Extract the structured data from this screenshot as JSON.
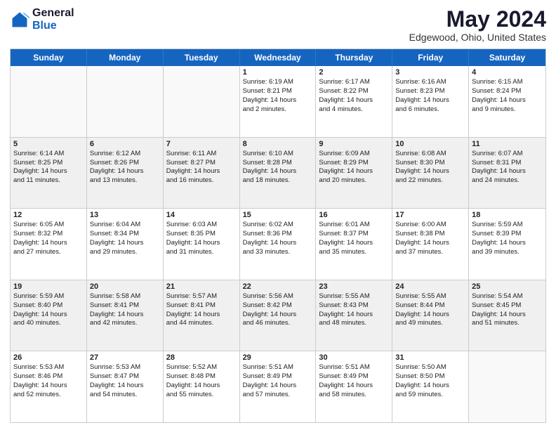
{
  "logo": {
    "general": "General",
    "blue": "Blue"
  },
  "title": "May 2024",
  "subtitle": "Edgewood, Ohio, United States",
  "header_days": [
    "Sunday",
    "Monday",
    "Tuesday",
    "Wednesday",
    "Thursday",
    "Friday",
    "Saturday"
  ],
  "rows": [
    [
      {
        "day": "",
        "lines": [],
        "empty": true
      },
      {
        "day": "",
        "lines": [],
        "empty": true
      },
      {
        "day": "",
        "lines": [],
        "empty": true
      },
      {
        "day": "1",
        "lines": [
          "Sunrise: 6:19 AM",
          "Sunset: 8:21 PM",
          "Daylight: 14 hours",
          "and 2 minutes."
        ]
      },
      {
        "day": "2",
        "lines": [
          "Sunrise: 6:17 AM",
          "Sunset: 8:22 PM",
          "Daylight: 14 hours",
          "and 4 minutes."
        ]
      },
      {
        "day": "3",
        "lines": [
          "Sunrise: 6:16 AM",
          "Sunset: 8:23 PM",
          "Daylight: 14 hours",
          "and 6 minutes."
        ]
      },
      {
        "day": "4",
        "lines": [
          "Sunrise: 6:15 AM",
          "Sunset: 8:24 PM",
          "Daylight: 14 hours",
          "and 9 minutes."
        ]
      }
    ],
    [
      {
        "day": "5",
        "lines": [
          "Sunrise: 6:14 AM",
          "Sunset: 8:25 PM",
          "Daylight: 14 hours",
          "and 11 minutes."
        ]
      },
      {
        "day": "6",
        "lines": [
          "Sunrise: 6:12 AM",
          "Sunset: 8:26 PM",
          "Daylight: 14 hours",
          "and 13 minutes."
        ]
      },
      {
        "day": "7",
        "lines": [
          "Sunrise: 6:11 AM",
          "Sunset: 8:27 PM",
          "Daylight: 14 hours",
          "and 16 minutes."
        ]
      },
      {
        "day": "8",
        "lines": [
          "Sunrise: 6:10 AM",
          "Sunset: 8:28 PM",
          "Daylight: 14 hours",
          "and 18 minutes."
        ]
      },
      {
        "day": "9",
        "lines": [
          "Sunrise: 6:09 AM",
          "Sunset: 8:29 PM",
          "Daylight: 14 hours",
          "and 20 minutes."
        ]
      },
      {
        "day": "10",
        "lines": [
          "Sunrise: 6:08 AM",
          "Sunset: 8:30 PM",
          "Daylight: 14 hours",
          "and 22 minutes."
        ]
      },
      {
        "day": "11",
        "lines": [
          "Sunrise: 6:07 AM",
          "Sunset: 8:31 PM",
          "Daylight: 14 hours",
          "and 24 minutes."
        ]
      }
    ],
    [
      {
        "day": "12",
        "lines": [
          "Sunrise: 6:05 AM",
          "Sunset: 8:32 PM",
          "Daylight: 14 hours",
          "and 27 minutes."
        ]
      },
      {
        "day": "13",
        "lines": [
          "Sunrise: 6:04 AM",
          "Sunset: 8:34 PM",
          "Daylight: 14 hours",
          "and 29 minutes."
        ]
      },
      {
        "day": "14",
        "lines": [
          "Sunrise: 6:03 AM",
          "Sunset: 8:35 PM",
          "Daylight: 14 hours",
          "and 31 minutes."
        ]
      },
      {
        "day": "15",
        "lines": [
          "Sunrise: 6:02 AM",
          "Sunset: 8:36 PM",
          "Daylight: 14 hours",
          "and 33 minutes."
        ]
      },
      {
        "day": "16",
        "lines": [
          "Sunrise: 6:01 AM",
          "Sunset: 8:37 PM",
          "Daylight: 14 hours",
          "and 35 minutes."
        ]
      },
      {
        "day": "17",
        "lines": [
          "Sunrise: 6:00 AM",
          "Sunset: 8:38 PM",
          "Daylight: 14 hours",
          "and 37 minutes."
        ]
      },
      {
        "day": "18",
        "lines": [
          "Sunrise: 5:59 AM",
          "Sunset: 8:39 PM",
          "Daylight: 14 hours",
          "and 39 minutes."
        ]
      }
    ],
    [
      {
        "day": "19",
        "lines": [
          "Sunrise: 5:59 AM",
          "Sunset: 8:40 PM",
          "Daylight: 14 hours",
          "and 40 minutes."
        ]
      },
      {
        "day": "20",
        "lines": [
          "Sunrise: 5:58 AM",
          "Sunset: 8:41 PM",
          "Daylight: 14 hours",
          "and 42 minutes."
        ]
      },
      {
        "day": "21",
        "lines": [
          "Sunrise: 5:57 AM",
          "Sunset: 8:41 PM",
          "Daylight: 14 hours",
          "and 44 minutes."
        ]
      },
      {
        "day": "22",
        "lines": [
          "Sunrise: 5:56 AM",
          "Sunset: 8:42 PM",
          "Daylight: 14 hours",
          "and 46 minutes."
        ]
      },
      {
        "day": "23",
        "lines": [
          "Sunrise: 5:55 AM",
          "Sunset: 8:43 PM",
          "Daylight: 14 hours",
          "and 48 minutes."
        ]
      },
      {
        "day": "24",
        "lines": [
          "Sunrise: 5:55 AM",
          "Sunset: 8:44 PM",
          "Daylight: 14 hours",
          "and 49 minutes."
        ]
      },
      {
        "day": "25",
        "lines": [
          "Sunrise: 5:54 AM",
          "Sunset: 8:45 PM",
          "Daylight: 14 hours",
          "and 51 minutes."
        ]
      }
    ],
    [
      {
        "day": "26",
        "lines": [
          "Sunrise: 5:53 AM",
          "Sunset: 8:46 PM",
          "Daylight: 14 hours",
          "and 52 minutes."
        ]
      },
      {
        "day": "27",
        "lines": [
          "Sunrise: 5:53 AM",
          "Sunset: 8:47 PM",
          "Daylight: 14 hours",
          "and 54 minutes."
        ]
      },
      {
        "day": "28",
        "lines": [
          "Sunrise: 5:52 AM",
          "Sunset: 8:48 PM",
          "Daylight: 14 hours",
          "and 55 minutes."
        ]
      },
      {
        "day": "29",
        "lines": [
          "Sunrise: 5:51 AM",
          "Sunset: 8:49 PM",
          "Daylight: 14 hours",
          "and 57 minutes."
        ]
      },
      {
        "day": "30",
        "lines": [
          "Sunrise: 5:51 AM",
          "Sunset: 8:49 PM",
          "Daylight: 14 hours",
          "and 58 minutes."
        ]
      },
      {
        "day": "31",
        "lines": [
          "Sunrise: 5:50 AM",
          "Sunset: 8:50 PM",
          "Daylight: 14 hours",
          "and 59 minutes."
        ]
      },
      {
        "day": "",
        "lines": [],
        "empty": true
      }
    ]
  ]
}
